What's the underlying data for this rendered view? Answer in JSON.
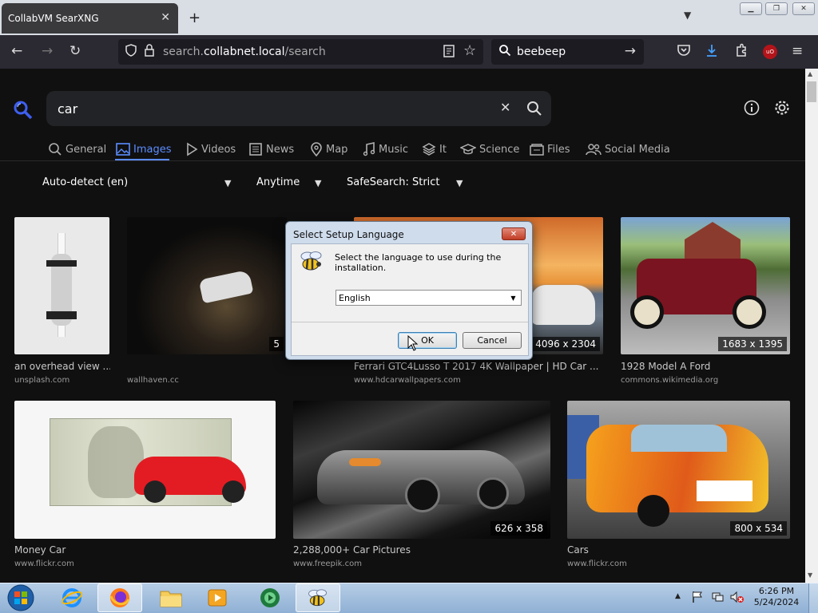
{
  "browser": {
    "tab_title": "CollabVM SearXNG",
    "url_prefix": "search.",
    "url_host": "collabnet.local",
    "url_path": "/search",
    "search_engine_text": "beebeep"
  },
  "search": {
    "query": "car",
    "categories": [
      {
        "label": "General",
        "icon": "search-icon"
      },
      {
        "label": "Images",
        "icon": "image-icon"
      },
      {
        "label": "Videos",
        "icon": "play-icon"
      },
      {
        "label": "News",
        "icon": "newspaper-icon"
      },
      {
        "label": "Map",
        "icon": "map-pin-icon"
      },
      {
        "label": "Music",
        "icon": "music-icon"
      },
      {
        "label": "It",
        "icon": "layers-icon"
      },
      {
        "label": "Science",
        "icon": "graduation-icon"
      },
      {
        "label": "Files",
        "icon": "files-icon"
      },
      {
        "label": "Social Media",
        "icon": "people-icon"
      }
    ],
    "active_category": "Images",
    "filters": {
      "language": "Auto-detect (en)",
      "time": "Anytime",
      "safesearch": "SafeSearch: Strict"
    }
  },
  "results": [
    {
      "title": "an overhead view ...",
      "source": "unsplash.com",
      "size": ""
    },
    {
      "title": "",
      "source": "wallhaven.cc",
      "size": "5"
    },
    {
      "title": "Ferrari GTC4Lusso T 2017 4K Wallpaper | HD Car ...",
      "source": "www.hdcarwallpapers.com",
      "size": "4096 x 2304"
    },
    {
      "title": "1928 Model A Ford",
      "source": "commons.wikimedia.org",
      "size": "1683 x 1395"
    },
    {
      "title": "Money Car",
      "source": "www.flickr.com",
      "size": ""
    },
    {
      "title": "2,288,000+ Car Pictures",
      "source": "www.freepik.com",
      "size": "626 x 358"
    },
    {
      "title": "Cars",
      "source": "www.flickr.com",
      "size": "800 x 534"
    }
  ],
  "dialog": {
    "title": "Select Setup Language",
    "message": "Select the language to use during the installation.",
    "selected_language": "English",
    "ok_label": "OK",
    "cancel_label": "Cancel"
  },
  "taskbar": {
    "time": "6:26 PM",
    "date": "5/24/2024"
  },
  "colors": {
    "accent": "#5c8dff",
    "page_bg": "#101010",
    "toolbar_bg": "#2b2a33"
  }
}
